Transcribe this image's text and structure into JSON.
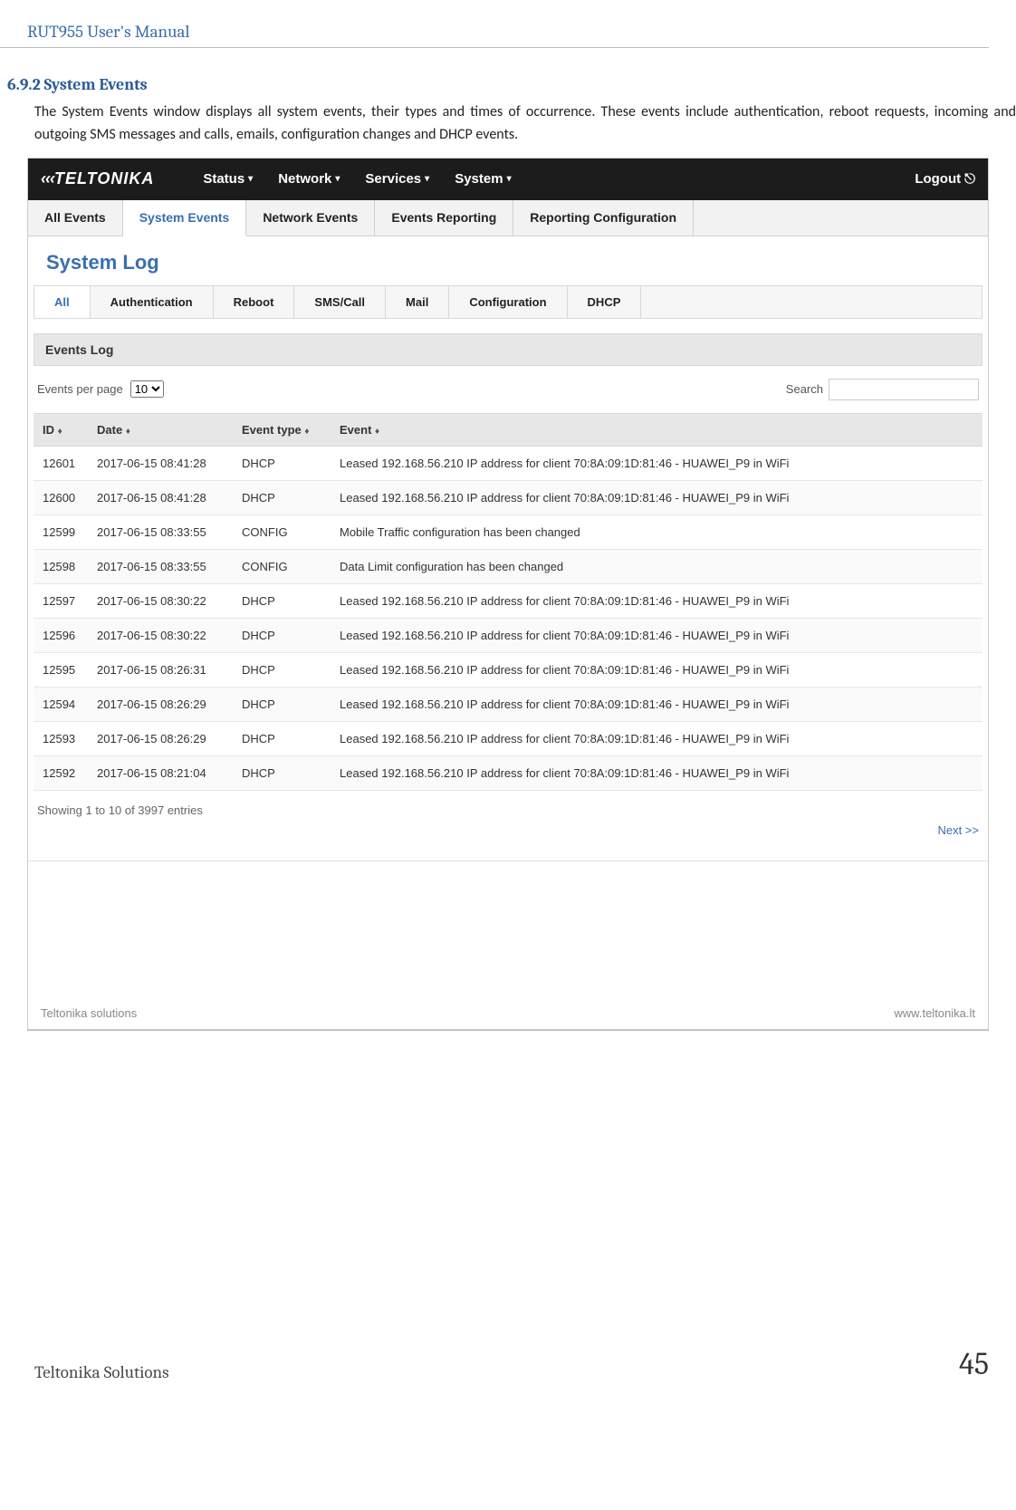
{
  "doc_header": "RUT955 User's Manual",
  "section_number": "6.9.2",
  "section_title": "System Events",
  "body_para": "The System Events window displays all system events, their types and times of occurrence. These events include authentication, reboot requests, incoming and outgoing SMS messages and calls, emails, configuration changes and DHCP events.",
  "topnav": {
    "items": [
      "Status",
      "Network",
      "Services",
      "System"
    ],
    "logout": "Logout",
    "brand": "TELTONIKA"
  },
  "tabs1": [
    "All Events",
    "System Events",
    "Network Events",
    "Events Reporting",
    "Reporting Configuration"
  ],
  "tabs1_active": 1,
  "page_heading": "System Log",
  "tabs2": [
    "All",
    "Authentication",
    "Reboot",
    "SMS/Call",
    "Mail",
    "Configuration",
    "DHCP"
  ],
  "tabs2_active": 0,
  "events_log_label": "Events Log",
  "per_page_label": "Events per page",
  "per_page_value": "10",
  "search_label": "Search",
  "columns": {
    "id": "ID",
    "date": "Date",
    "type": "Event type",
    "event": "Event"
  },
  "rows": [
    {
      "id": "12601",
      "date": "2017-06-15 08:41:28",
      "type": "DHCP",
      "event": "Leased 192.168.56.210 IP address for client 70:8A:09:1D:81:46 - HUAWEI_P9 in WiFi"
    },
    {
      "id": "12600",
      "date": "2017-06-15 08:41:28",
      "type": "DHCP",
      "event": "Leased 192.168.56.210 IP address for client 70:8A:09:1D:81:46 - HUAWEI_P9 in WiFi"
    },
    {
      "id": "12599",
      "date": "2017-06-15 08:33:55",
      "type": "CONFIG",
      "event": "Mobile Traffic configuration has been changed"
    },
    {
      "id": "12598",
      "date": "2017-06-15 08:33:55",
      "type": "CONFIG",
      "event": "Data Limit configuration has been changed"
    },
    {
      "id": "12597",
      "date": "2017-06-15 08:30:22",
      "type": "DHCP",
      "event": "Leased 192.168.56.210 IP address for client 70:8A:09:1D:81:46 - HUAWEI_P9 in WiFi"
    },
    {
      "id": "12596",
      "date": "2017-06-15 08:30:22",
      "type": "DHCP",
      "event": "Leased 192.168.56.210 IP address for client 70:8A:09:1D:81:46 - HUAWEI_P9 in WiFi"
    },
    {
      "id": "12595",
      "date": "2017-06-15 08:26:31",
      "type": "DHCP",
      "event": "Leased 192.168.56.210 IP address for client 70:8A:09:1D:81:46 - HUAWEI_P9 in WiFi"
    },
    {
      "id": "12594",
      "date": "2017-06-15 08:26:29",
      "type": "DHCP",
      "event": "Leased 192.168.56.210 IP address for client 70:8A:09:1D:81:46 - HUAWEI_P9 in WiFi"
    },
    {
      "id": "12593",
      "date": "2017-06-15 08:26:29",
      "type": "DHCP",
      "event": "Leased 192.168.56.210 IP address for client 70:8A:09:1D:81:46 - HUAWEI_P9 in WiFi"
    },
    {
      "id": "12592",
      "date": "2017-06-15 08:21:04",
      "type": "DHCP",
      "event": "Leased 192.168.56.210 IP address for client 70:8A:09:1D:81:46 - HUAWEI_P9 in WiFi"
    }
  ],
  "entries_status": "Showing 1 to 10 of 3997 entries",
  "next_label": "Next >>",
  "sc_footer_left": "Teltonika solutions",
  "sc_footer_right": "www.teltonika.lt",
  "doc_footer_left": "Teltonika Solutions",
  "doc_footer_right": "45"
}
